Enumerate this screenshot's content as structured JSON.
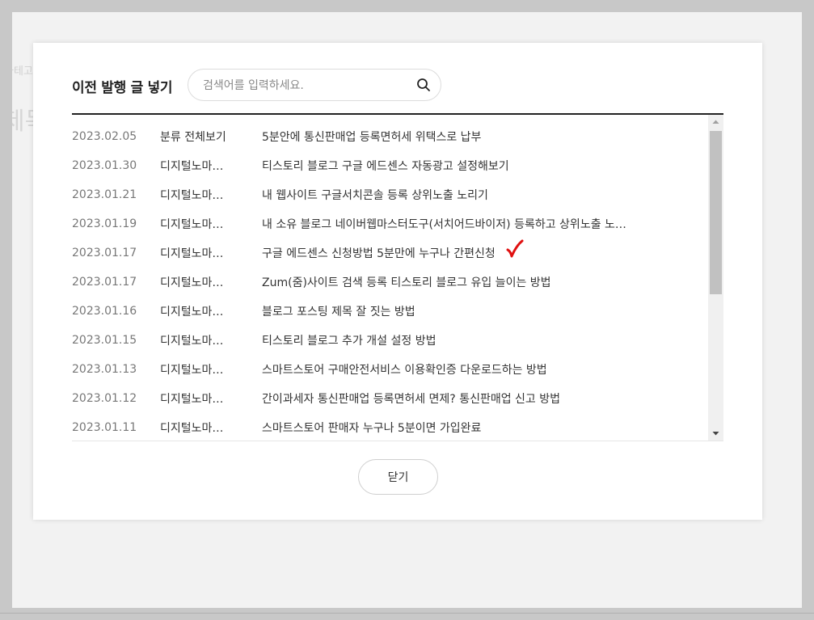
{
  "background": {
    "ghost_text_1": "카테고",
    "ghost_text_2": "제목",
    "ghost_text_3": "                                   "
  },
  "modal": {
    "title": "이전 발행 글 넣기",
    "search": {
      "placeholder": "검색어를 입력하세요.",
      "value": ""
    },
    "posts": [
      {
        "date": "2023.02.05",
        "category": "분류 전체보기",
        "title": "5분안에 통신판매업 등록면허세 위택스로 납부"
      },
      {
        "date": "2023.01.30",
        "category": "디지털노마…",
        "title": "티스토리 블로그 구글 에드센스 자동광고 설정해보기"
      },
      {
        "date": "2023.01.21",
        "category": "디지털노마…",
        "title": "내 웹사이트 구글서치콘솔 등록 상위노출 노리기"
      },
      {
        "date": "2023.01.19",
        "category": "디지털노마…",
        "title": "내 소유 블로그 네이버웹마스터도구(서치어드바이저) 등록하고 상위노출 노…"
      },
      {
        "date": "2023.01.17",
        "category": "디지털노마…",
        "title": "구글 에드센스 신청방법 5분만에 누구나 간편신청"
      },
      {
        "date": "2023.01.17",
        "category": "디지털노마…",
        "title": "Zum(줌)사이트 검색 등록 티스토리 블로그 유입 늘이는 방법"
      },
      {
        "date": "2023.01.16",
        "category": "디지털노마…",
        "title": "블로그 포스팅 제목 잘 짓는 방법"
      },
      {
        "date": "2023.01.15",
        "category": "디지털노마…",
        "title": "티스토리 블로그 추가 개설 설정 방법"
      },
      {
        "date": "2023.01.13",
        "category": "디지털노마…",
        "title": "스마트스토어 구매안전서비스 이용확인증 다운로드하는 방법"
      },
      {
        "date": "2023.01.12",
        "category": "디지털노마…",
        "title": "간이과세자 통신판매업 등록면허세 면제? 통신판매업 신고 방법"
      },
      {
        "date": "2023.01.11",
        "category": "디지털노마…",
        "title": "스마트스토어 판매자 누구나 5분이면 가입완료"
      }
    ],
    "close_label": "닫기"
  },
  "colors": {
    "annotation_check": "#e01010",
    "scroll_thumb": "#c1c1c1",
    "divider": "#222222"
  },
  "icons": {
    "search": "search-icon",
    "annotation": "red-checkmark-icon",
    "scroll_up": "scroll-up-arrow-icon",
    "scroll_down": "scroll-down-arrow-icon"
  }
}
